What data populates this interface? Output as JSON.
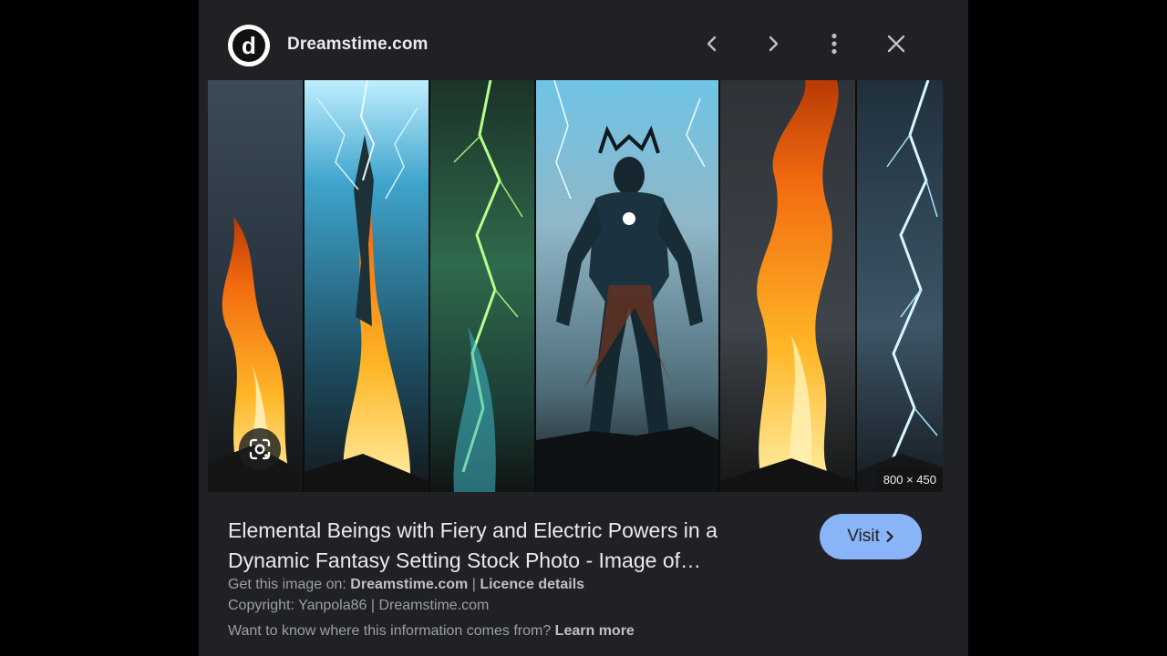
{
  "header": {
    "site_name": "Dreamstime.com",
    "logo_letter": "d",
    "icons": [
      "chevron-left-icon",
      "chevron-right-icon",
      "more-vert-icon",
      "close-icon"
    ]
  },
  "image": {
    "dimensions": "800 × 450",
    "lens_icon": "google-lens-icon"
  },
  "result": {
    "title": "Elemental Beings with Fiery and Electric Powers in a Dynamic Fantasy Setting Stock Photo - Image of…",
    "visit_label": "Visit",
    "get_image_prefix": "Get this image on:",
    "get_image_site": "Dreamstime.com",
    "separator": "|",
    "licence_label": "Licence details",
    "copyright": "Copyright: Yanpola86 | Dreamstime.com",
    "info_question": "Want to know where this information comes from?",
    "learn_more": "Learn more"
  },
  "colors": {
    "background": "#000000",
    "panel": "#202124",
    "accent_button": "#8ab4f8",
    "primary_text": "#e8eaed",
    "secondary_text": "#9aa0a6"
  }
}
